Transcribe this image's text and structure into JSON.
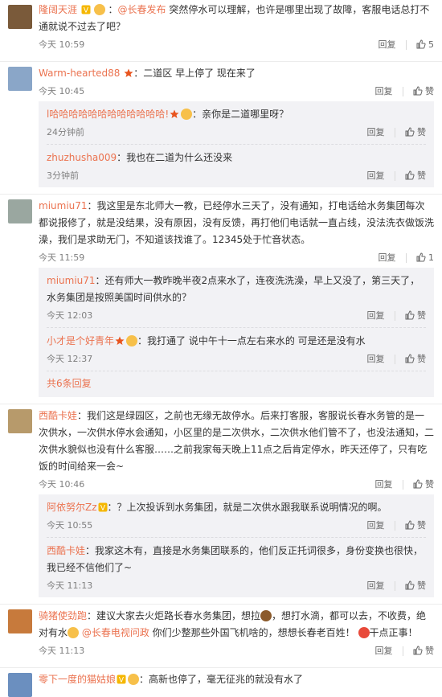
{
  "comments": [
    {
      "nick": "隆阔天涯",
      "at": "@长春发布",
      "text": " 突然停水可以理解，也许是哪里出现了故障，客服电话总打不通就说不过去了吧？",
      "time": "今天 10:59",
      "reply": "回复",
      "likes": "5",
      "avatar_color": "#7a5a3a"
    },
    {
      "nick": "Warm-hearted88",
      "text": "：二道区 早上停了 现在来了",
      "time": "今天 10:45",
      "reply": "回复",
      "like_label": "赞",
      "avatar_color": "#8aa6c8",
      "replies": [
        {
          "nick": "l哈哈哈哈哈哈哈哈哈哈哈哈!",
          "text": "：亲你是二道哪里呀？",
          "time": "24分钟前",
          "reply": "回复",
          "like_label": "赞"
        },
        {
          "nick": "zhuzhusha009",
          "text": "：我也在二道为什么还没来",
          "time": "3分钟前",
          "reply": "回复",
          "like_label": "赞"
        }
      ]
    },
    {
      "nick": "miumiu71",
      "text": "：我这里是东北师大一教，已经停水三天了，没有通知，打电话给水务集团每次都说报修了，就是没结果，没有原因，没有反馈，再打他们电话就一直占线，没法洗衣做饭洗澡，我们是求助无门，不知道该找谁了。12345处于忙音状态。",
      "time": "今天 11:59",
      "reply": "回复",
      "likes": "1",
      "avatar_color": "#9aa7a0",
      "replies": [
        {
          "nick": "miumiu71",
          "text": "：还有师大一教昨晚半夜2点来水了，连夜洗洗澡，早上又没了，第三天了，水务集团是按照美国时间供水的？",
          "time": "今天 12:03",
          "reply": "回复",
          "like_label": "赞"
        },
        {
          "nick": "小才是个好青年",
          "text": "：我打通了 说中午十一点左右来水的 可是还是没有水",
          "time": "今天 12:37",
          "reply": "回复",
          "like_label": "赞"
        }
      ],
      "more": "共6条回复"
    },
    {
      "nick": "西酷卡娃",
      "text": "：我们这是绿园区，之前也无缘无故停水。后来打客服，客服说长春水务管的是一次供水，一次供水停水会通知，小区里的是二次供水，二次供水他们管不了，也没法通知，二次供水貌似也没有什么客服……之前我家每天晚上11点之后肯定停水，昨天还停了，只有吃饭的时间给来一会~",
      "time": "今天 10:46",
      "reply": "回复",
      "like_label": "赞",
      "avatar_color": "#b79a6b",
      "replies": [
        {
          "nick": "阿依努尔Zz",
          "text": "：？上次投诉到水务集团，就是二次供水跟我联系说明情况的啊。",
          "time": "今天 10:55",
          "reply": "回复",
          "like_label": "赞"
        },
        {
          "nick": "西酷卡娃",
          "text": "：我家这木有，直接是水务集团联系的，他们反正托词很多，身份变换也很快，我已经不信他们了~",
          "time": "今天 11:13",
          "reply": "回复",
          "like_label": "赞"
        }
      ]
    },
    {
      "nick": "骑猪使劲跑",
      "text_a": "：建议大家去火炬路长春水务集团，想拉",
      "text_b": "，想打水滴，都可以去，不收费，绝对有水",
      "at": "@长春电视问政",
      "text_c": " 你们少整那些外国飞机啥的，想想长春老百姓！",
      "tag": "干点正事！",
      "time": "今天 11:13",
      "reply": "回复",
      "like_label": "赞",
      "avatar_color": "#c77a3c"
    },
    {
      "nick": "零下一度的猫姑娘",
      "text": "：高新也停了，毫无征兆的就没有水了",
      "avatar_color": "#6b8fbf"
    }
  ]
}
